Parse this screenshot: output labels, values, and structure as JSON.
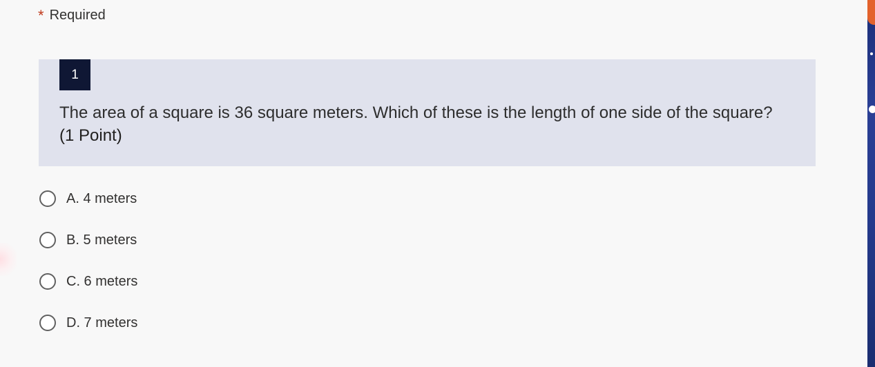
{
  "form": {
    "required_marker": "*",
    "required_label": "Required"
  },
  "question": {
    "number": "1",
    "text": "The area of a square is 36 square meters. Which of these is the length of one side of the square?",
    "points": "(1 Point)"
  },
  "options": [
    {
      "label": "A. 4 meters",
      "selected": false
    },
    {
      "label": "B. 5 meters",
      "selected": false
    },
    {
      "label": "C. 6 meters",
      "selected": false
    },
    {
      "label": "D. 7 meters",
      "selected": false
    }
  ],
  "colors": {
    "page_background": "#f8f8f8",
    "question_card": "#e0e2ed",
    "number_badge": "#0f1734",
    "required_asterisk": "#c0391b",
    "side_strip": "#243a8c",
    "side_accent": "#e3622c"
  }
}
